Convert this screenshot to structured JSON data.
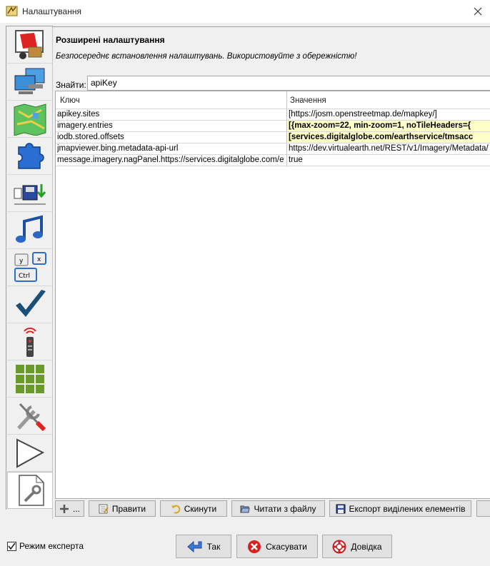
{
  "window": {
    "title": "Налаштування"
  },
  "panel": {
    "heading": "Розширені налаштування",
    "description": "Безпосереднє встановлення налаштувань. Використовуйте з обережністю!",
    "search": {
      "label": "Знайти:",
      "value": "apiKey"
    }
  },
  "table": {
    "columns": [
      "Ключ",
      "Значення"
    ],
    "rows": [
      {
        "key": "apikey.sites",
        "value": "[https://josm.openstreetmap.de/mapkey/]",
        "modified": false
      },
      {
        "key": "imagery.entries",
        "value": "[{max-zoom=22, min-zoom=1, noTileHeaders={",
        "modified": true
      },
      {
        "key": "iodb.stored.offsets",
        "value": "[services.digitalglobe.com/earthservice/tmsacc",
        "modified": true
      },
      {
        "key": "jmapviewer.bing.metadata-api-url",
        "value": "https://dev.virtualearth.net/REST/v1/Imagery/Metadata/",
        "modified": false
      },
      {
        "key": "message.imagery.nagPanel.https://services.digitalglobe.com/ea...",
        "value": "true",
        "modified": false
      }
    ]
  },
  "actions": {
    "add": "...",
    "edit": "Правити",
    "reset": "Скинути",
    "read_file": "Читати з файлу",
    "export": "Експорт виділених елементів"
  },
  "footer": {
    "expert_mode": "Режим експерта",
    "ok": "Так",
    "cancel": "Скасувати",
    "help": "Довідка"
  },
  "nav_icons": [
    "display-preferences-icon",
    "connection-preferences-icon",
    "map-icon",
    "plugin-icon",
    "data-save-icon",
    "audio-icon",
    "shortcuts-icon",
    "validator-icon",
    "remote-control-icon",
    "tagging-presets-icon",
    "tools-icon",
    "map-paint-icon",
    "advanced-preferences-icon"
  ],
  "colors": {
    "modified_row_bg": "#ffffc8",
    "selection_border": "#c0c0c0"
  }
}
